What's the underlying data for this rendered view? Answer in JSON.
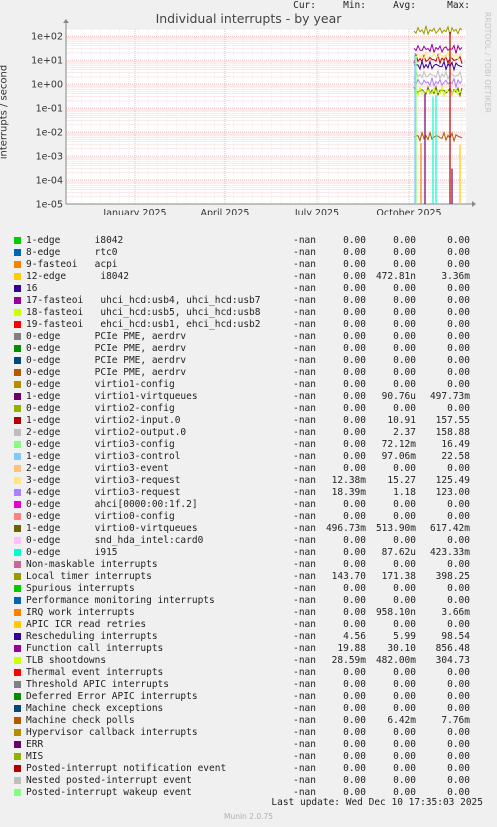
{
  "title": "Individual interrupts - by year",
  "ylabel": "interrupts / second",
  "side_text": "RRDTOOL / TOBI OETIKER",
  "footer": "Last update: Wed Dec 10 17:35:03 2025",
  "munin_version": "Munin 2.0.75",
  "columns": {
    "cur": "Cur:",
    "min": "Min:",
    "avg": "Avg:",
    "max": "Max:"
  },
  "chart_data": {
    "type": "line",
    "title": "Individual interrupts - by year",
    "ylabel": "interrupts / second",
    "yscale": "log",
    "ylim": [
      1e-05,
      200
    ],
    "yticks": [
      "1e+02",
      "1e+01",
      "1e+00",
      "1e-01",
      "1e-02",
      "1e-03",
      "1e-04",
      "1e-05"
    ],
    "xticks": [
      "January 2025",
      "April 2025",
      "July 2025",
      "October 2025"
    ],
    "grid": true,
    "data_region": "last two months (late Oct – Dec 2025)"
  },
  "legend": [
    {
      "name": "1-edge      i8042",
      "color": "#00cc00",
      "cur": "-nan",
      "min": "0.00",
      "avg": "0.00",
      "max": "0.00"
    },
    {
      "name": "8-edge      rtc0",
      "color": "#0066b3",
      "cur": "-nan",
      "min": "0.00",
      "avg": "0.00",
      "max": "0.00"
    },
    {
      "name": "9-fasteoi   acpi",
      "color": "#ff8000",
      "cur": "-nan",
      "min": "0.00",
      "avg": "0.00",
      "max": "0.00"
    },
    {
      "name": "12-edge      i8042",
      "color": "#ffcc00",
      "cur": "-nan",
      "min": "0.00",
      "avg": "472.81n",
      "max": "3.36m"
    },
    {
      "name": "16",
      "color": "#330099",
      "cur": "-nan",
      "min": "0.00",
      "avg": "0.00",
      "max": "0.00"
    },
    {
      "name": "17-fasteoi   uhci_hcd:usb4, uhci_hcd:usb7",
      "color": "#990099",
      "cur": "-nan",
      "min": "0.00",
      "avg": "0.00",
      "max": "0.00"
    },
    {
      "name": "18-fasteoi   uhci_hcd:usb5, uhci_hcd:usb8",
      "color": "#ccff00",
      "cur": "-nan",
      "min": "0.00",
      "avg": "0.00",
      "max": "0.00"
    },
    {
      "name": "19-fasteoi   ehci_hcd:usb1, ehci_hcd:usb2",
      "color": "#ff0000",
      "cur": "-nan",
      "min": "0.00",
      "avg": "0.00",
      "max": "0.00"
    },
    {
      "name": "0-edge      PCIe PME, aerdrv",
      "color": "#808080",
      "cur": "-nan",
      "min": "0.00",
      "avg": "0.00",
      "max": "0.00"
    },
    {
      "name": "0-edge      PCIe PME, aerdrv",
      "color": "#008f00",
      "cur": "-nan",
      "min": "0.00",
      "avg": "0.00",
      "max": "0.00"
    },
    {
      "name": "0-edge      PCIe PME, aerdrv",
      "color": "#00487d",
      "cur": "-nan",
      "min": "0.00",
      "avg": "0.00",
      "max": "0.00"
    },
    {
      "name": "0-edge      PCIe PME, aerdrv",
      "color": "#b35a00",
      "cur": "-nan",
      "min": "0.00",
      "avg": "0.00",
      "max": "0.00"
    },
    {
      "name": "0-edge      virtio1-config",
      "color": "#b38f00",
      "cur": "-nan",
      "min": "0.00",
      "avg": "0.00",
      "max": "0.00"
    },
    {
      "name": "1-edge      virtio1-virtqueues",
      "color": "#6b006b",
      "cur": "-nan",
      "min": "0.00",
      "avg": "90.76u",
      "max": "497.73m"
    },
    {
      "name": "0-edge      virtio2-config",
      "color": "#8fb300",
      "cur": "-nan",
      "min": "0.00",
      "avg": "0.00",
      "max": "0.00"
    },
    {
      "name": "1-edge      virtio2-input.0",
      "color": "#b30000",
      "cur": "-nan",
      "min": "0.00",
      "avg": "10.91",
      "max": "157.55"
    },
    {
      "name": "2-edge      virtio2-output.0",
      "color": "#bebebe",
      "cur": "-nan",
      "min": "0.00",
      "avg": "2.37",
      "max": "158.88"
    },
    {
      "name": "0-edge      virtio3-config",
      "color": "#80ff80",
      "cur": "-nan",
      "min": "0.00",
      "avg": "72.12m",
      "max": "16.49"
    },
    {
      "name": "1-edge      virtio3-control",
      "color": "#80c9ff",
      "cur": "-nan",
      "min": "0.00",
      "avg": "97.06m",
      "max": "22.58"
    },
    {
      "name": "2-edge      virtio3-event",
      "color": "#ffc080",
      "cur": "-nan",
      "min": "0.00",
      "avg": "0.00",
      "max": "0.00"
    },
    {
      "name": "3-edge      virtio3-request",
      "color": "#ffe680",
      "cur": "-nan",
      "min": "12.38m",
      "avg": "15.27",
      "max": "125.49"
    },
    {
      "name": "4-edge      virtio3-request",
      "color": "#aa80ff",
      "cur": "-nan",
      "min": "18.39m",
      "avg": "1.18",
      "max": "123.00"
    },
    {
      "name": "0-edge      ahci[0000:00:1f.2]",
      "color": "#ee00cc",
      "cur": "-nan",
      "min": "0.00",
      "avg": "0.00",
      "max": "0.00"
    },
    {
      "name": "0-edge      virtio0-config",
      "color": "#ff8080",
      "cur": "-nan",
      "min": "0.00",
      "avg": "0.00",
      "max": "0.00"
    },
    {
      "name": "1-edge      virtio0-virtqueues",
      "color": "#666600",
      "cur": "-nan",
      "min": "496.73m",
      "avg": "513.90m",
      "max": "617.42m"
    },
    {
      "name": "0-edge      snd_hda_intel:card0",
      "color": "#ffbfff",
      "cur": "-nan",
      "min": "0.00",
      "avg": "0.00",
      "max": "0.00"
    },
    {
      "name": "0-edge      i915",
      "color": "#00ffcc",
      "cur": "-nan",
      "min": "0.00",
      "avg": "87.62u",
      "max": "423.33m"
    },
    {
      "name": "Non-maskable interrupts",
      "color": "#cc6699",
      "cur": "-nan",
      "min": "0.00",
      "avg": "0.00",
      "max": "0.00"
    },
    {
      "name": "Local timer interrupts",
      "color": "#999900",
      "cur": "-nan",
      "min": "143.70",
      "avg": "171.38",
      "max": "398.25"
    },
    {
      "name": "Spurious interrupts",
      "color": "#00cc00",
      "cur": "-nan",
      "min": "0.00",
      "avg": "0.00",
      "max": "0.00"
    },
    {
      "name": "Performance monitoring interrupts",
      "color": "#0066b3",
      "cur": "-nan",
      "min": "0.00",
      "avg": "0.00",
      "max": "0.00"
    },
    {
      "name": "IRQ work interrupts",
      "color": "#ff8000",
      "cur": "-nan",
      "min": "0.00",
      "avg": "958.10n",
      "max": "3.66m"
    },
    {
      "name": "APIC ICR read retries",
      "color": "#ffcc00",
      "cur": "-nan",
      "min": "0.00",
      "avg": "0.00",
      "max": "0.00"
    },
    {
      "name": "Rescheduling interrupts",
      "color": "#330099",
      "cur": "-nan",
      "min": "4.56",
      "avg": "5.99",
      "max": "98.54"
    },
    {
      "name": "Function call interrupts",
      "color": "#990099",
      "cur": "-nan",
      "min": "19.88",
      "avg": "30.10",
      "max": "856.48"
    },
    {
      "name": "TLB shootdowns",
      "color": "#ccff00",
      "cur": "-nan",
      "min": "28.59m",
      "avg": "482.00m",
      "max": "304.73"
    },
    {
      "name": "Thermal event interrupts",
      "color": "#ff0000",
      "cur": "-nan",
      "min": "0.00",
      "avg": "0.00",
      "max": "0.00"
    },
    {
      "name": "Threshold APIC interrupts",
      "color": "#808080",
      "cur": "-nan",
      "min": "0.00",
      "avg": "0.00",
      "max": "0.00"
    },
    {
      "name": "Deferred Error APIC interrupts",
      "color": "#008f00",
      "cur": "-nan",
      "min": "0.00",
      "avg": "0.00",
      "max": "0.00"
    },
    {
      "name": "Machine check exceptions",
      "color": "#00487d",
      "cur": "-nan",
      "min": "0.00",
      "avg": "0.00",
      "max": "0.00"
    },
    {
      "name": "Machine check polls",
      "color": "#b35a00",
      "cur": "-nan",
      "min": "0.00",
      "avg": "6.42m",
      "max": "7.76m"
    },
    {
      "name": "Hypervisor callback interrupts",
      "color": "#b38f00",
      "cur": "-nan",
      "min": "0.00",
      "avg": "0.00",
      "max": "0.00"
    },
    {
      "name": "ERR",
      "color": "#6b006b",
      "cur": "-nan",
      "min": "0.00",
      "avg": "0.00",
      "max": "0.00"
    },
    {
      "name": "MIS",
      "color": "#8fb300",
      "cur": "-nan",
      "min": "0.00",
      "avg": "0.00",
      "max": "0.00"
    },
    {
      "name": "Posted-interrupt notification event",
      "color": "#b30000",
      "cur": "-nan",
      "min": "0.00",
      "avg": "0.00",
      "max": "0.00"
    },
    {
      "name": "Nested posted-interrupt event",
      "color": "#bebebe",
      "cur": "-nan",
      "min": "0.00",
      "avg": "0.00",
      "max": "0.00"
    },
    {
      "name": "Posted-interrupt wakeup event",
      "color": "#80ff80",
      "cur": "-nan",
      "min": "0.00",
      "avg": "0.00",
      "max": "0.00"
    }
  ]
}
